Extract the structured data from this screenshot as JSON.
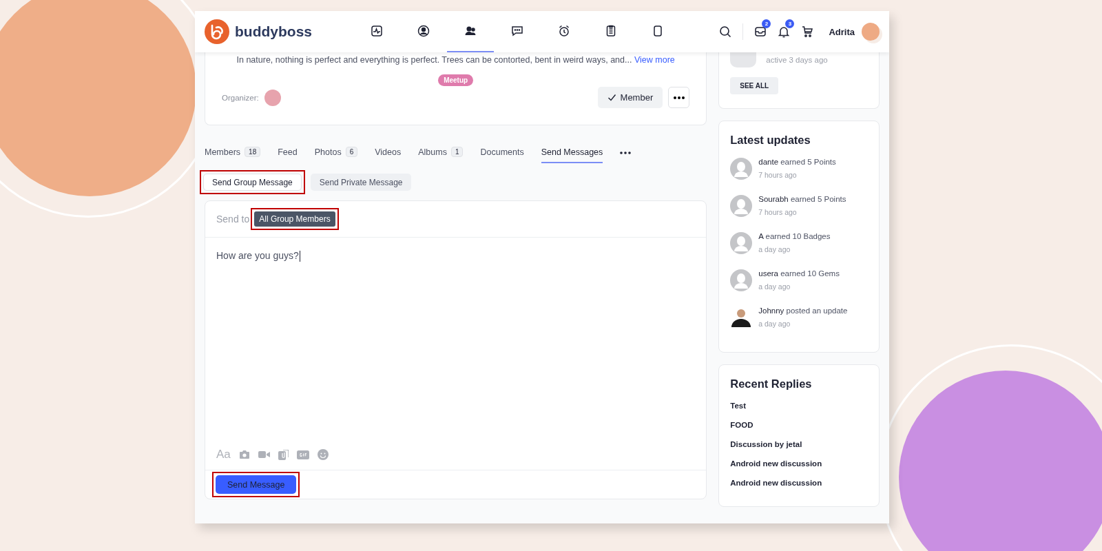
{
  "header": {
    "logo_text": "buddyboss",
    "nav_items": [
      {
        "selected": false
      },
      {
        "selected": false
      },
      {
        "selected": true
      },
      {
        "selected": false
      },
      {
        "selected": false
      },
      {
        "selected": false
      },
      {
        "selected": false
      }
    ],
    "inbox_count": "2",
    "notification_count": "3",
    "user_name": "Adrita"
  },
  "group_card": {
    "description": "In nature, nothing is perfect and everything is perfect. Trees can be contorted, bent in weird ways, and...",
    "view_more": "View more",
    "tag": "Meetup",
    "organizer_label": "Organizer:",
    "member_button": "Member"
  },
  "tabs": [
    {
      "label": "Members",
      "count": "18",
      "selected": false
    },
    {
      "label": "Feed",
      "selected": false
    },
    {
      "label": "Photos",
      "count": "6",
      "selected": false
    },
    {
      "label": "Videos",
      "selected": false
    },
    {
      "label": "Albums",
      "count": "1",
      "selected": false
    },
    {
      "label": "Documents",
      "selected": false
    },
    {
      "label": "Send Messages",
      "selected": true
    }
  ],
  "sub_tabs": [
    {
      "label": "Send Group Message",
      "selected": true,
      "highlighted": true
    },
    {
      "label": "Send Private Message",
      "selected": false,
      "highlighted": false
    }
  ],
  "composer": {
    "send_to_label": "Send to",
    "recipient": "All Group Members",
    "recipient_highlighted": true,
    "message": "How are you guys?",
    "format_label": "Aa",
    "send_button": "Send Message",
    "send_highlighted": true
  },
  "sidebar": {
    "members_card": {
      "last_active": "active 3 days ago",
      "see_all": "SEE ALL"
    },
    "latest_updates": {
      "title": "Latest updates",
      "items": [
        {
          "name": "dante",
          "action": "earned 5 Points",
          "time": "7 hours ago",
          "kind": "generic"
        },
        {
          "name": "Sourabh",
          "action": "earned 5 Points",
          "time": "7 hours ago",
          "kind": "generic"
        },
        {
          "name": "A",
          "action": "earned 10 Badges",
          "time": "a day ago",
          "kind": "generic"
        },
        {
          "name": "usera",
          "action": "earned 10 Gems",
          "time": "a day ago",
          "kind": "generic"
        },
        {
          "name": "Johnny",
          "action": "posted an update",
          "time": "a day ago",
          "kind": "photo"
        }
      ]
    },
    "recent_replies": {
      "title": "Recent Replies",
      "items": [
        "Test",
        "FOOD",
        "Discussion by jetal",
        "Android new discussion",
        "Android new discussion"
      ]
    }
  }
}
